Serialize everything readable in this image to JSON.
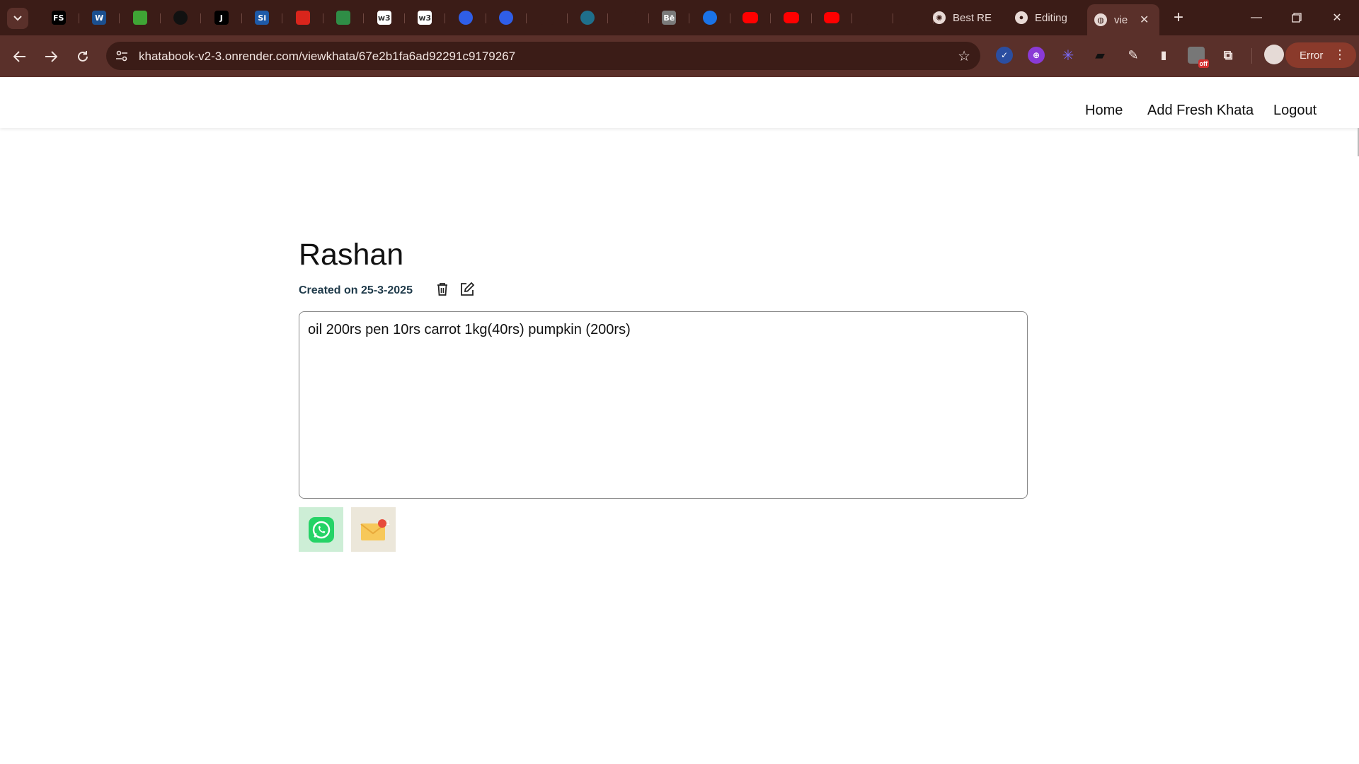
{
  "browser": {
    "pinned_tabs": [
      {
        "icon": "fs-icon",
        "text": "FS",
        "bg": "#000000"
      },
      {
        "icon": "w-icon",
        "text": "W",
        "bg": "#1b4f8f"
      },
      {
        "icon": "green-logo-icon",
        "text": "",
        "bg": "#3fa535"
      },
      {
        "icon": "clock-icon",
        "text": "",
        "bg": "#111111"
      },
      {
        "icon": "j-icon",
        "text": "J",
        "bg": "#000000"
      },
      {
        "icon": "si-icon",
        "text": "Si",
        "bg": "#1e5aa8"
      },
      {
        "icon": "oracle-icon",
        "text": "",
        "bg": "#d9251c"
      },
      {
        "icon": "gfg-icon",
        "text": "",
        "bg": "#2f8d46"
      },
      {
        "icon": "w3-icon",
        "text": "w3",
        "bg": "#ffffff"
      },
      {
        "icon": "w3-icon",
        "text": "w3",
        "bg": "#ffffff"
      },
      {
        "icon": "k-icon",
        "text": "",
        "bg": "#2f5ee8"
      },
      {
        "icon": "k-icon",
        "text": "",
        "bg": "#2f5ee8"
      },
      {
        "icon": "network-icon",
        "text": "",
        "bg": "#3b1c17"
      },
      {
        "icon": "globe-icon",
        "text": "",
        "bg": "#1f6f8b"
      },
      {
        "icon": "stack-icon",
        "text": "",
        "bg": "#3b1c17"
      },
      {
        "icon": "behance-icon",
        "text": "Bē",
        "bg": "#7a7a7a"
      },
      {
        "icon": "play-icon",
        "text": "",
        "bg": "#1a73e8"
      },
      {
        "icon": "youtube-icon",
        "text": "",
        "bg": "#ff0000"
      },
      {
        "icon": "youtube-icon",
        "text": "",
        "bg": "#ff0000"
      },
      {
        "icon": "youtube-icon",
        "text": "",
        "bg": "#ff0000"
      },
      {
        "icon": "sailboat-icon",
        "text": "",
        "bg": "#3b1c17"
      },
      {
        "icon": "sailboat-icon",
        "text": "",
        "bg": "#3b1c17"
      }
    ],
    "tabs": [
      {
        "icon": "openai-icon",
        "label": "Best RE"
      },
      {
        "icon": "github-icon",
        "label": "Editing"
      },
      {
        "icon": "globe-icon",
        "label": "vie"
      }
    ],
    "url": "khatabook-v2-3.onrender.com/viewkhata/67e2b1fa6ad92291c9179267",
    "profile_error_label": "Error"
  },
  "nav": {
    "home": "Home",
    "add_fresh_khata": "Add Fresh Khata",
    "logout": "Logout"
  },
  "khata": {
    "title": "Rashan",
    "created": "Created on 25-3-2025",
    "content": "oil 200rs pen 10rs carrot 1kg(40rs) pumpkin (200rs)",
    "mail_badge": "1"
  }
}
